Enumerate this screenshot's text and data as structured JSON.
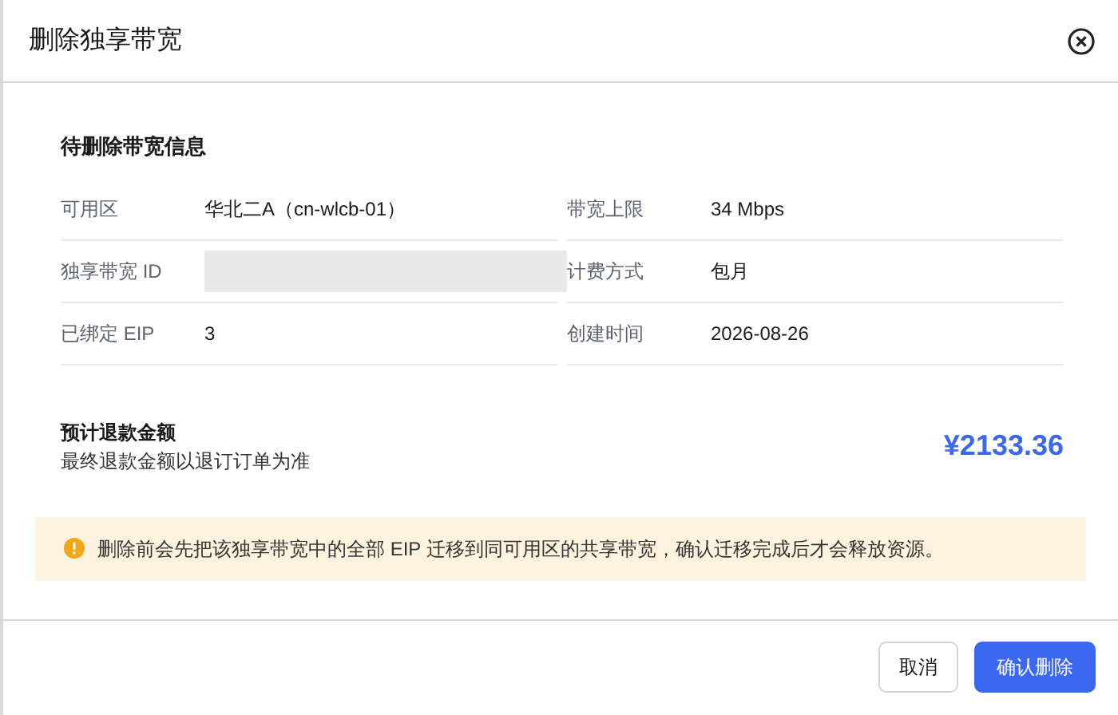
{
  "dialog": {
    "title": "删除独享带宽"
  },
  "info": {
    "heading": "待删除带宽信息",
    "fields": [
      {
        "label": "可用区",
        "value": "华北二A（cn-wlcb-01）"
      },
      {
        "label": "带宽上限",
        "value": "34 Mbps"
      },
      {
        "label": "独享带宽 ID",
        "redacted": true
      },
      {
        "label": "计费方式",
        "value": "包月"
      },
      {
        "label": "已绑定 EIP",
        "value": "3"
      },
      {
        "label": "创建时间",
        "value": "2026-08-26"
      }
    ]
  },
  "refund": {
    "title": "预计退款金额",
    "note": "最终退款金额以退订订单为准",
    "amount": "¥2133.36"
  },
  "warning": {
    "text": "删除前会先把该独享带宽中的全部 EIP 迁移到同可用区的共享带宽，确认迁移完成后才会释放资源。"
  },
  "buttons": [
    {
      "label": "取消",
      "kind": "secondary"
    },
    {
      "label": "确认删除",
      "kind": "primary"
    }
  ]
}
